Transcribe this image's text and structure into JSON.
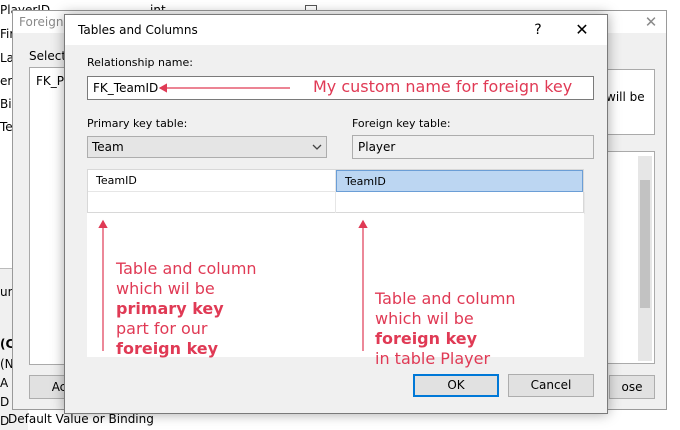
{
  "background": {
    "designer_rows": [
      "PlayerID",
      "First",
      "Last",
      "ers",
      "Birth",
      "Tea"
    ],
    "designer_type": "int",
    "prop_rows": [
      "um",
      "(C",
      "(N",
      "A",
      "D",
      "D"
    ],
    "default_value_label": "Default Value or Binding",
    "fk_window": {
      "title": "Foreign Ke",
      "close_glyph": "✕",
      "selected_label": "Selected",
      "list_item": "FK_Play",
      "right_text": "will be",
      "add_button": "Ac",
      "close_button": "ose"
    }
  },
  "dialog": {
    "title": "Tables and Columns",
    "help_glyph": "?",
    "close_glyph": "✕",
    "relationship_label": "Relationship name:",
    "relationship_value": "FK_TeamID",
    "pk_table_label": "Primary key table:",
    "pk_table_value": "Team",
    "fk_table_label": "Foreign key table:",
    "fk_table_value": "Player",
    "columns": [
      {
        "pk": "TeamID",
        "fk": "TeamID"
      },
      {
        "pk": "",
        "fk": ""
      }
    ],
    "ok_label": "OK",
    "cancel_label": "Cancel"
  },
  "annotations": {
    "name_note": "My custom name for foreign key",
    "pk_note": {
      "line1": "Table and column",
      "line2": "which wil be",
      "line3": "primary key",
      "line4": "part for our",
      "line5": "foreign key"
    },
    "fk_note": {
      "line1": "Table and column",
      "line2": "which wil be",
      "line3": "foreign key",
      "line4": "in table Player"
    },
    "color": "#e03a55"
  }
}
